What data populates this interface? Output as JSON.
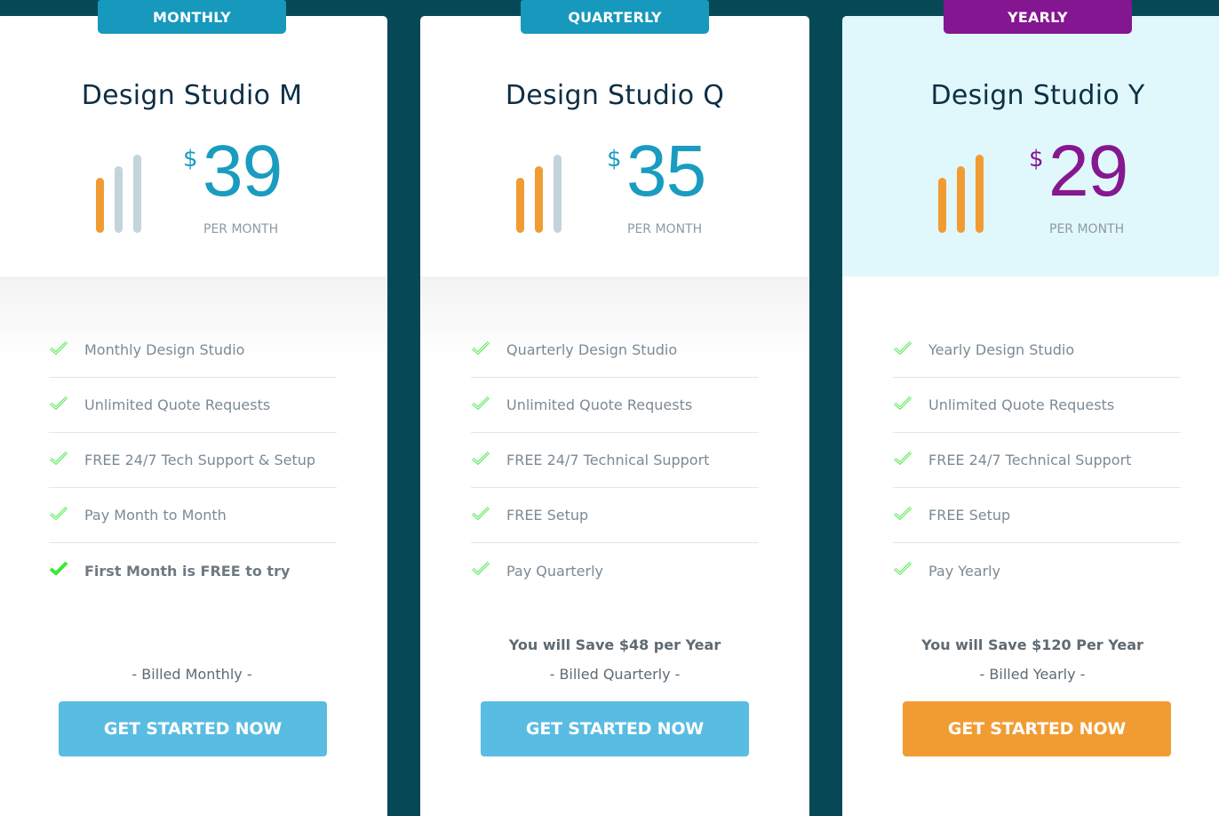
{
  "colors": {
    "background": "#074857",
    "badge_blue": "#1699bd",
    "badge_purple": "#851691",
    "price_blue": "#1a9cc0",
    "price_purple": "#86188f",
    "bar_orange": "#f19c33",
    "bar_gray": "#c4d4db",
    "button_blue": "#59bce2",
    "button_orange": "#f19c33",
    "highlight_head": "#e0f7fc",
    "check_green": "#3be73b"
  },
  "plans": [
    {
      "badge": "MONTHLY",
      "title": "Design Studio M",
      "currency": "$",
      "price": "39",
      "period": "PER MONTH",
      "tier_bars_filled": 1,
      "tier_bars_total": 3,
      "features": [
        {
          "text": "Monthly Design Studio",
          "icon": "check-icon",
          "bold": false
        },
        {
          "text": "Unlimited Quote Requests",
          "icon": "check-icon",
          "bold": false
        },
        {
          "text": "FREE 24/7 Tech Support & Setup",
          "icon": "check-icon",
          "bold": false
        },
        {
          "text": "Pay Month to Month",
          "icon": "check-icon",
          "bold": false
        },
        {
          "text": "First Month is FREE to try",
          "icon": "check-icon",
          "bold": true
        }
      ],
      "savings": "",
      "billed": "- Billed Monthly -",
      "cta": "GET STARTED NOW"
    },
    {
      "badge": "QUARTERLY",
      "title": "Design Studio Q",
      "currency": "$",
      "price": "35",
      "period": "PER MONTH",
      "tier_bars_filled": 2,
      "tier_bars_total": 3,
      "features": [
        {
          "text": "Quarterly Design Studio",
          "icon": "check-icon",
          "bold": false
        },
        {
          "text": "Unlimited Quote Requests",
          "icon": "check-icon",
          "bold": false
        },
        {
          "text": "FREE 24/7 Technical Support",
          "icon": "check-icon",
          "bold": false
        },
        {
          "text": "FREE Setup",
          "icon": "check-icon",
          "bold": false
        },
        {
          "text": "Pay Quarterly",
          "icon": "check-icon",
          "bold": false
        }
      ],
      "savings": "You will Save $48 per Year",
      "billed": "- Billed Quarterly -",
      "cta": "GET STARTED NOW"
    },
    {
      "badge": "YEARLY",
      "title": "Design Studio Y",
      "currency": "$",
      "price": "29",
      "period": "PER MONTH",
      "tier_bars_filled": 3,
      "tier_bars_total": 3,
      "features": [
        {
          "text": "Yearly Design Studio",
          "icon": "check-icon",
          "bold": false
        },
        {
          "text": "Unlimited Quote Requests",
          "icon": "check-icon",
          "bold": false
        },
        {
          "text": "FREE 24/7 Technical Support",
          "icon": "check-icon",
          "bold": false
        },
        {
          "text": "FREE Setup",
          "icon": "check-icon",
          "bold": false
        },
        {
          "text": "Pay Yearly",
          "icon": "check-icon",
          "bold": false
        }
      ],
      "savings": "You will Save $120 Per Year",
      "billed": "- Billed Yearly -",
      "cta": "GET STARTED NOW"
    }
  ]
}
